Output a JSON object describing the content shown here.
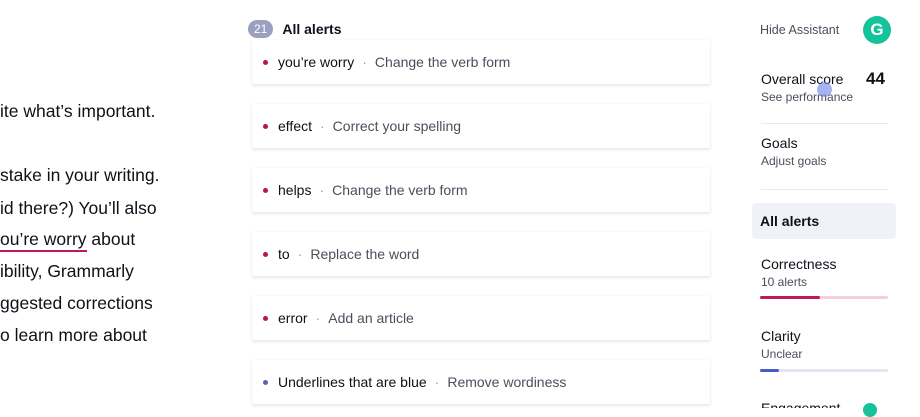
{
  "editor": {
    "lines": [
      "ite what’s important.",
      "stake in your writing.",
      "id there?) You’ll also",
      "ou’re worry",
      " about",
      "ibility, Grammarly",
      "ggested corrections",
      "o learn more about"
    ]
  },
  "alerts": {
    "count": "21",
    "title": "All alerts",
    "items": [
      {
        "word": "you’re worry",
        "desc": "Change the verb form",
        "sep": "·"
      },
      {
        "word": "effect",
        "desc": "Correct your spelling",
        "sep": "·"
      },
      {
        "word": "helps",
        "desc": "Change the verb form",
        "sep": "·"
      },
      {
        "word": "to",
        "desc": "Replace the word",
        "sep": "·"
      },
      {
        "word": "error",
        "desc": "Add an article",
        "sep": "·"
      },
      {
        "word": "Underlines that are blue",
        "desc": "Remove wordiness",
        "sep": "·"
      }
    ]
  },
  "sidebar": {
    "hide_assistant": "Hide Assistant",
    "logo_letter": "G",
    "overall": {
      "title": "Overall score",
      "sub": "See performance",
      "score": "44"
    },
    "goals": {
      "title": "Goals",
      "sub": "Adjust goals"
    },
    "all_alerts": "All alerts",
    "correctness": {
      "title": "Correctness",
      "sub": "10 alerts",
      "progress": 0.47
    },
    "clarity": {
      "title": "Clarity",
      "sub": "Unclear",
      "progress": 0.15
    },
    "engagement": {
      "title": "Engagement"
    }
  },
  "colors": {
    "correctness": "#c2185b",
    "clarity": "#4b5bc4",
    "brand": "#15c39a",
    "dot_red": "#b5174f",
    "dot_blue": "#5a62b5"
  }
}
